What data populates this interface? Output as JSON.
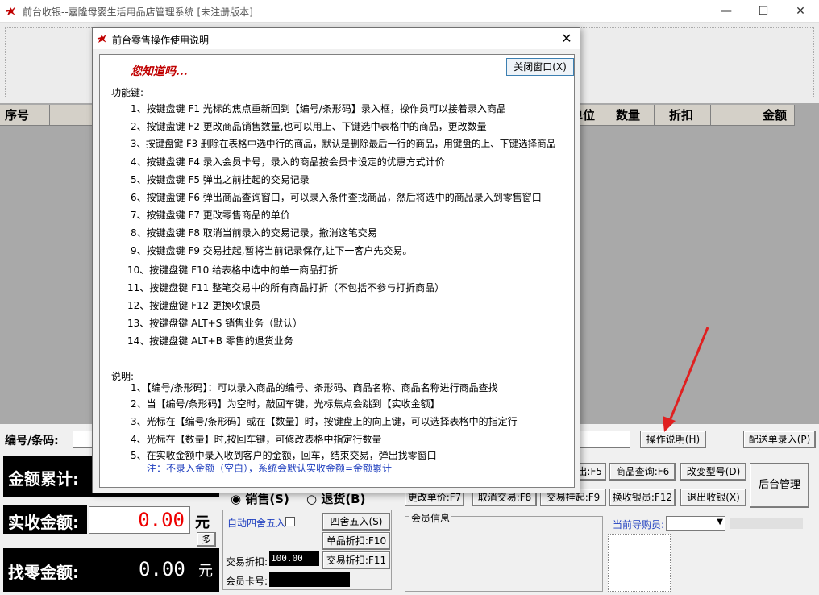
{
  "window": {
    "title": "前台收银--嘉隆母婴生活用品店管理系统 [未注册版本]",
    "min_icon": "minimize-icon",
    "max_icon": "maximize-icon",
    "close_icon": "close-icon"
  },
  "grid": {
    "columns": [
      "序号",
      "单位",
      "数量",
      "折扣",
      "金额"
    ]
  },
  "bottom": {
    "code_label": "编号/条码:",
    "btn_help": "操作说明(H)",
    "btn_delivery": "配送单录入(P)",
    "amount_total_label": "金额累计:",
    "paid_label": "实收金额:",
    "paid_value": "0.00",
    "yuan": "元",
    "duo": "多",
    "change_label": "找零金额:",
    "change_value": "0.00",
    "sale_label": "销售(S)",
    "return_label": "退货(B)",
    "auto_round_label": "自动四舍五入",
    "btn_round": "四舍五入(S)",
    "btn_item_discount": "单品折扣:F10",
    "trade_discount_label": "交易折扣:",
    "trade_discount_value": "100.00",
    "btn_trade_discount": "交易折扣:F11",
    "member_card_label": "会员卡号:",
    "btn_pop_f5": "出:F5",
    "btn_query_f6": "商品查询:F6",
    "btn_change_model": "改变型号(D)",
    "btn_backend": "后台管理",
    "btn_change_price": "更改单价:F7",
    "btn_cancel_trade": "取消交易:F8",
    "btn_hold_trade": "交易挂起:F9",
    "btn_change_cashier": "换收银员:F12",
    "btn_exit_cashier": "退出收银(X)",
    "member_info_label": "会员信息",
    "guide_label": "当前导购员:"
  },
  "dialog": {
    "title": "前台零售操作使用说明",
    "tip_title": "您知道吗...",
    "close_btn": "关闭窗口(X)",
    "func_title": "功能键:",
    "func_lines": [
      "1、按键盘键 F1 光标的焦点重新回到【编号/条形码】录入框，操作员可以接着录入商品",
      "2、按键盘键 F2 更改商品销售数量,也可以用上、下键选中表格中的商品，更改数量",
      "3、按键盘键 F3 删除在表格中选中行的商品，默认是删除最后一行的商品，用键盘的上、下键选择商品",
      "4、按键盘键 F4 录入会员卡号，录入的商品按会员卡设定的优惠方式计价",
      "5、按键盘键 F5 弹出之前挂起的交易记录",
      "6、按键盘键 F6 弹出商品查询窗口，可以录入条件查找商品，然后将选中的商品录入到零售窗口",
      "7、按键盘键 F7 更改零售商品的单价",
      "8、按键盘键 F8 取消当前录入的交易记录，撤消这笔交易",
      "9、按键盘键 F9 交易挂起,暂将当前记录保存,让下一客户先交易。",
      "10、按键盘键 F10 给表格中选中的单一商品打折",
      "11、按键盘键 F11 整笔交易中的所有商品打折（不包括不参与打折商品）",
      "12、按键盘键 F12 更换收银员",
      "13、按键盘键 ALT+S 销售业务（默认）",
      "14、按键盘键 ALT+B 零售的退货业务"
    ],
    "desc_title": "说明:",
    "desc_lines": [
      "1、【编号/条形码】：可以录入商品的编号、条形码、商品名称、商品名称进行商品查找",
      "2、当【编号/条形码】为空时，敲回车键，光标焦点会跳到【实收金额】",
      "3、光标在【编号/条形码】或在【数量】时，按键盘上的向上键，可以选择表格中的指定行",
      "4、光标在【数量】时,按回车键，可修改表格中指定行数量",
      "5、在实收金额中录入收到客户的金额，回车，结束交易，弹出找零窗口"
    ],
    "note": "注：不录入金额（空白），系统会默认实收金额=金额累计"
  },
  "colors": {
    "accent_red": "#c00000",
    "arrow_red": "#e02020",
    "note_blue": "#1f3fbf"
  }
}
